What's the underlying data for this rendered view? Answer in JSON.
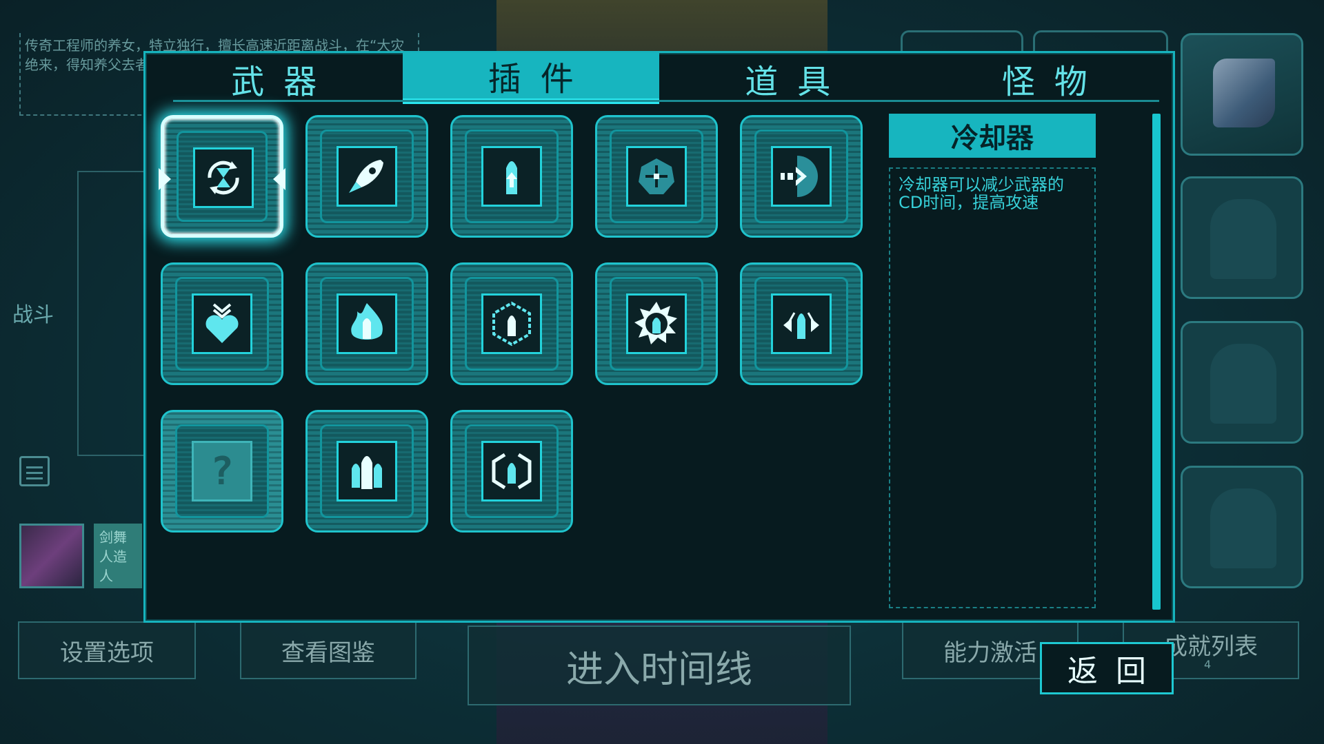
{
  "background": {
    "story_text": "传奇工程师的养女，特立独行，擅长高速近距离战斗，在“大灾绝来，得知养父去者”的计划。",
    "combat_label": "战斗",
    "avatar_label": "剑舞 人造人",
    "buttons": {
      "settings": "设置选项",
      "codex": "查看图鉴",
      "timeline": "进入时间线",
      "ability": "能力激活",
      "achievements": "成就列表"
    },
    "achievement_count": "4"
  },
  "tabs": [
    {
      "label": "武器",
      "active": false
    },
    {
      "label": "插件",
      "active": true
    },
    {
      "label": "道具",
      "active": false
    },
    {
      "label": "怪物",
      "active": false
    }
  ],
  "slots": [
    {
      "icon": "cooldown-icon",
      "selected": true,
      "locked": false
    },
    {
      "icon": "rocket-icon",
      "selected": false,
      "locked": false
    },
    {
      "icon": "bullet-upgrade-icon",
      "selected": false,
      "locked": false
    },
    {
      "icon": "crosshair-shield-icon",
      "selected": false,
      "locked": false
    },
    {
      "icon": "dash-arrow-icon",
      "selected": false,
      "locked": false
    },
    {
      "icon": "heart-absorb-icon",
      "selected": false,
      "locked": false
    },
    {
      "icon": "fire-bullet-icon",
      "selected": false,
      "locked": false
    },
    {
      "icon": "hex-bullet-icon",
      "selected": false,
      "locked": false
    },
    {
      "icon": "burst-bullet-icon",
      "selected": false,
      "locked": false
    },
    {
      "icon": "spread-bullet-icon",
      "selected": false,
      "locked": false
    },
    {
      "icon": "unknown-icon",
      "selected": false,
      "locked": true,
      "text": "?"
    },
    {
      "icon": "triple-bullet-icon",
      "selected": false,
      "locked": false
    },
    {
      "icon": "shield-bullet-icon",
      "selected": false,
      "locked": false
    }
  ],
  "info": {
    "title": "冷却器",
    "description": "冷却器可以减少武器的CD时间，提高攻速"
  },
  "back_button": "返回",
  "colors": {
    "accent": "#17b5bf",
    "glow": "#2fe3ee",
    "panel_bg": "#071b1f"
  }
}
